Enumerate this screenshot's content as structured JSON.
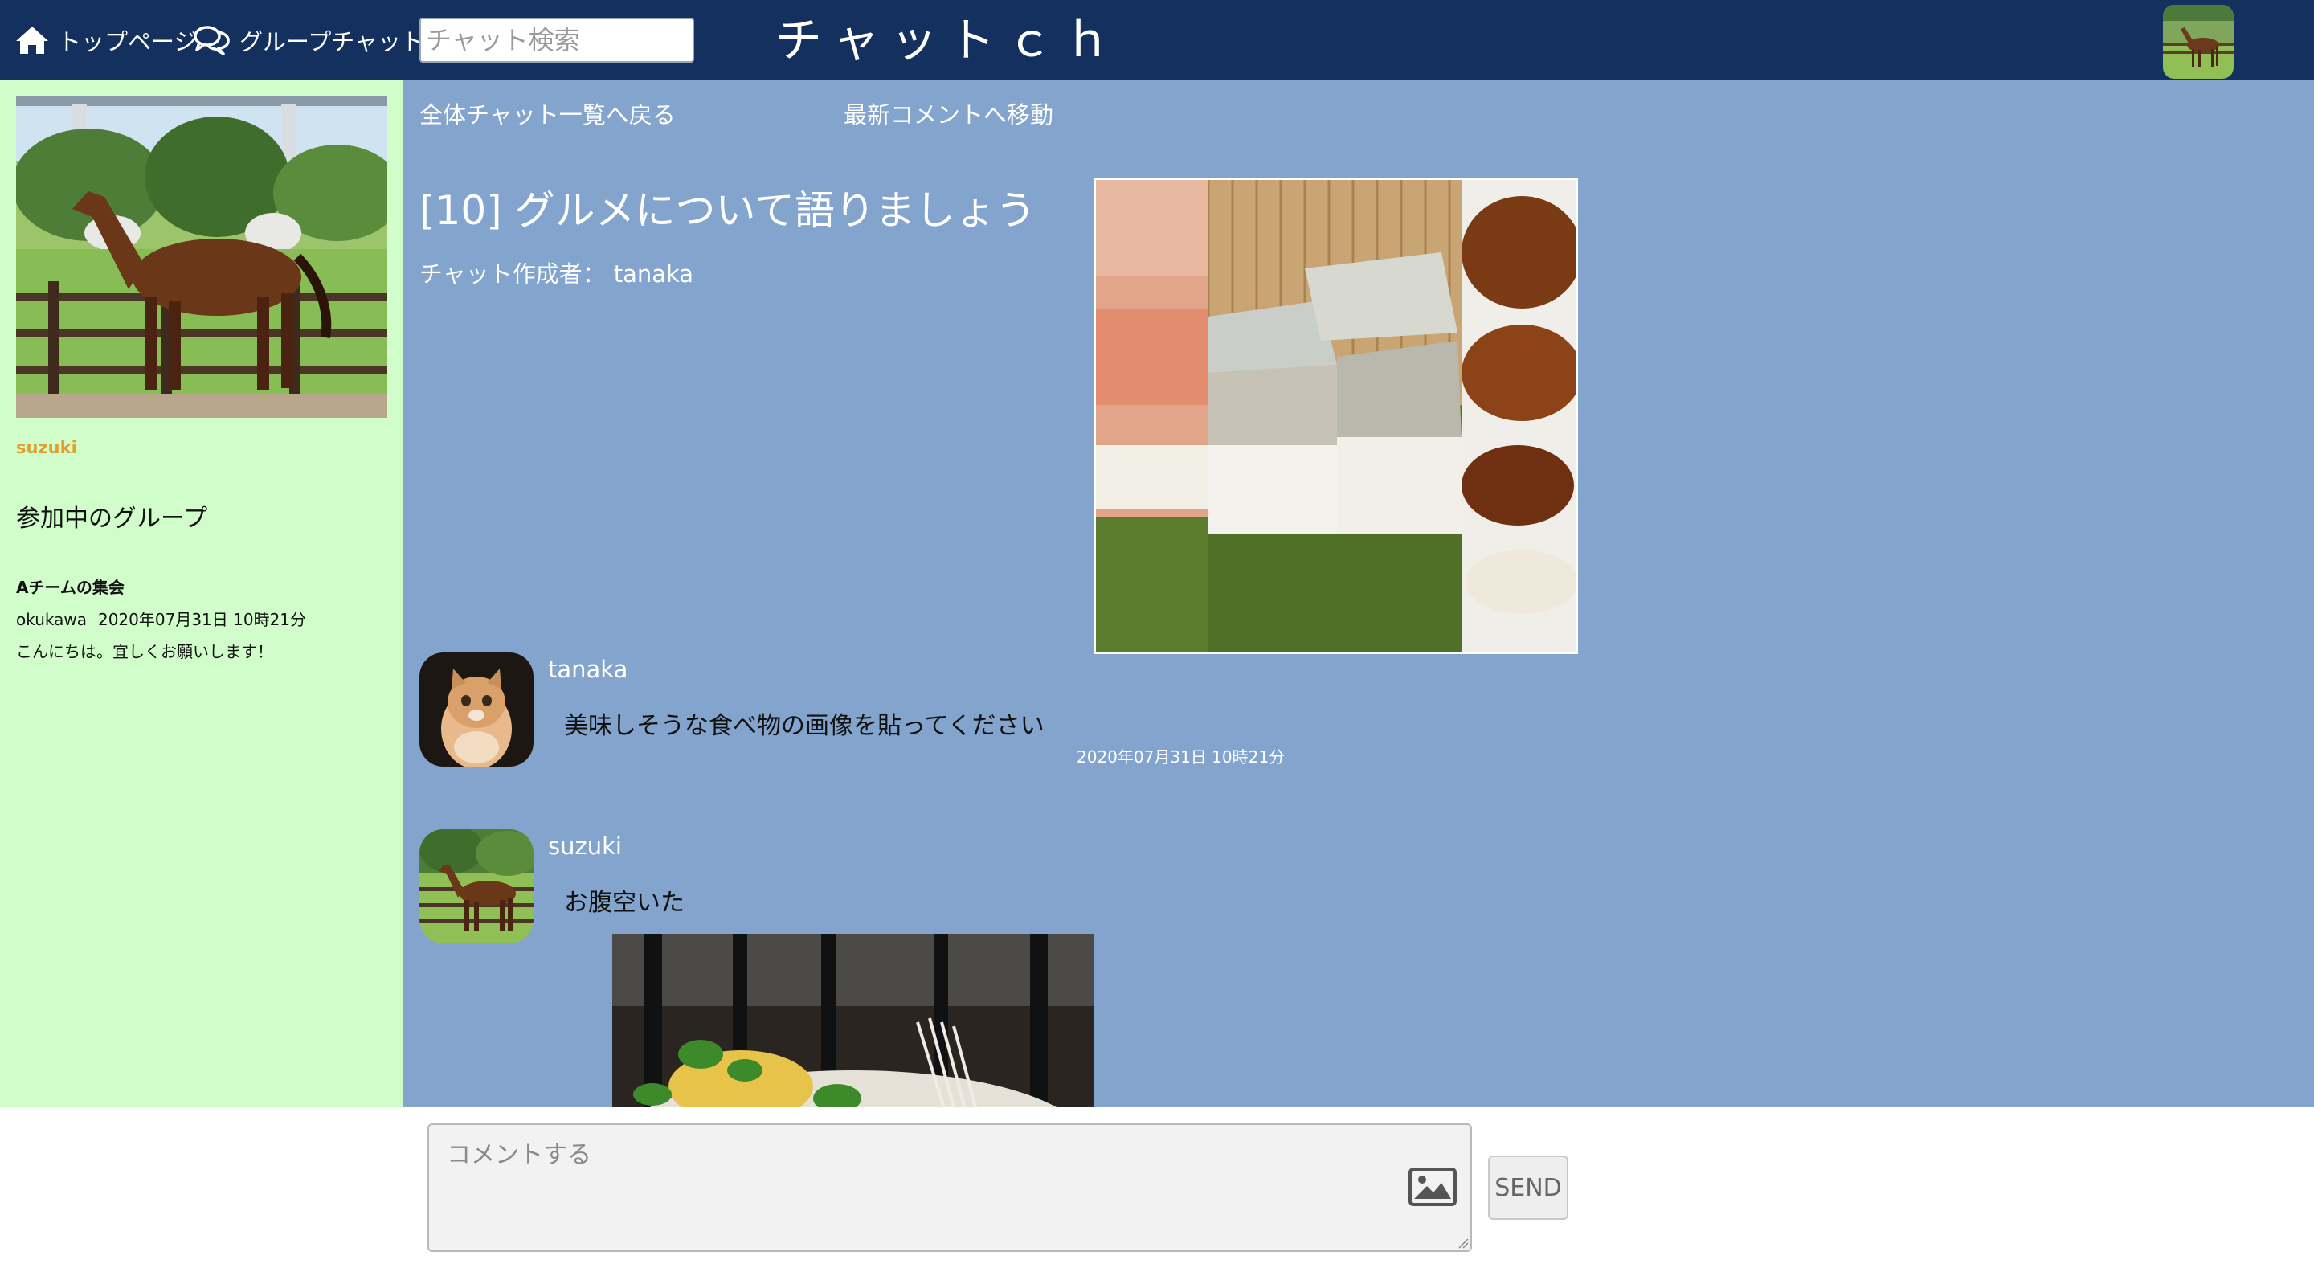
{
  "header": {
    "nav": {
      "top_page": "トップページ",
      "group_chat": "グループチャット"
    },
    "search": {
      "placeholder": "チャット検索"
    },
    "brand": "チャットｃｈ",
    "avatar_icon": "horse-photo"
  },
  "sidebar": {
    "profile_name": "suzuki",
    "groups_title": "参加中のグループ",
    "groups": [
      {
        "name": "Aチームの集会",
        "user": "okukawa",
        "date": "2020年07月31日 10時21分",
        "message": "こんにちは。宜しくお願いします！"
      }
    ]
  },
  "main": {
    "back_link": "全体チャット一覧へ戻る",
    "latest_link": "最新コメントへ移動",
    "chat_title": "[10] グルメについて語りましょう",
    "author_label": "チャット作成者：",
    "author_name": "tanaka",
    "messages": [
      {
        "user": "tanaka",
        "text": "美味しそうな食べ物の画像を貼ってください",
        "time": "2020年07月31日 10時21分",
        "avatar": "cat-photo"
      },
      {
        "user": "suzuki",
        "text": "お腹空いた",
        "avatar": "horse-photo",
        "image": "food-photo"
      }
    ]
  },
  "footer": {
    "comment_placeholder": "コメントする",
    "send_label": "SEND"
  },
  "colors": {
    "header_bg": "#13305f",
    "sidebar_bg": "#d1fdcb",
    "main_bg": "#83a4cc",
    "accent_name": "#e0a030"
  }
}
